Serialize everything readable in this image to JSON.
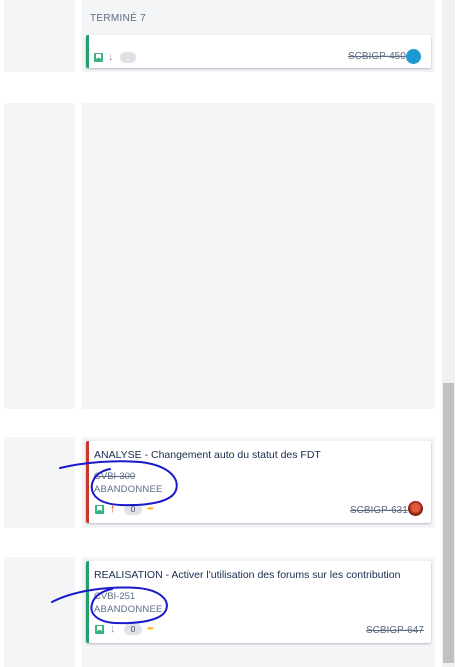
{
  "column": {
    "title": "TERMINÉ 7"
  },
  "top_card": {
    "issue_key": "SCBIGP-450"
  },
  "cards": [
    {
      "title": "ANALYSE - Changement auto du statut des FDT",
      "old_key": "CVBI-300",
      "status": "ABANDONNEE",
      "count": "0",
      "issue_key": "SCBIGP-631",
      "epic_color": "#c9372c",
      "priority": "up-arrow-icon"
    },
    {
      "title": "REALISATION - Activer l'utilisation des forums sur les contribution",
      "old_key": "CVBI-251",
      "status": "ABANDONNEE",
      "count": "0",
      "issue_key": "SCBIGP-647",
      "epic_color": "#22a06b",
      "priority": "down-arrow-icon"
    }
  ],
  "colors": {
    "accent": "#0052cc",
    "column_bg": "#f4f5f7",
    "annotation": "#1a1acc"
  }
}
